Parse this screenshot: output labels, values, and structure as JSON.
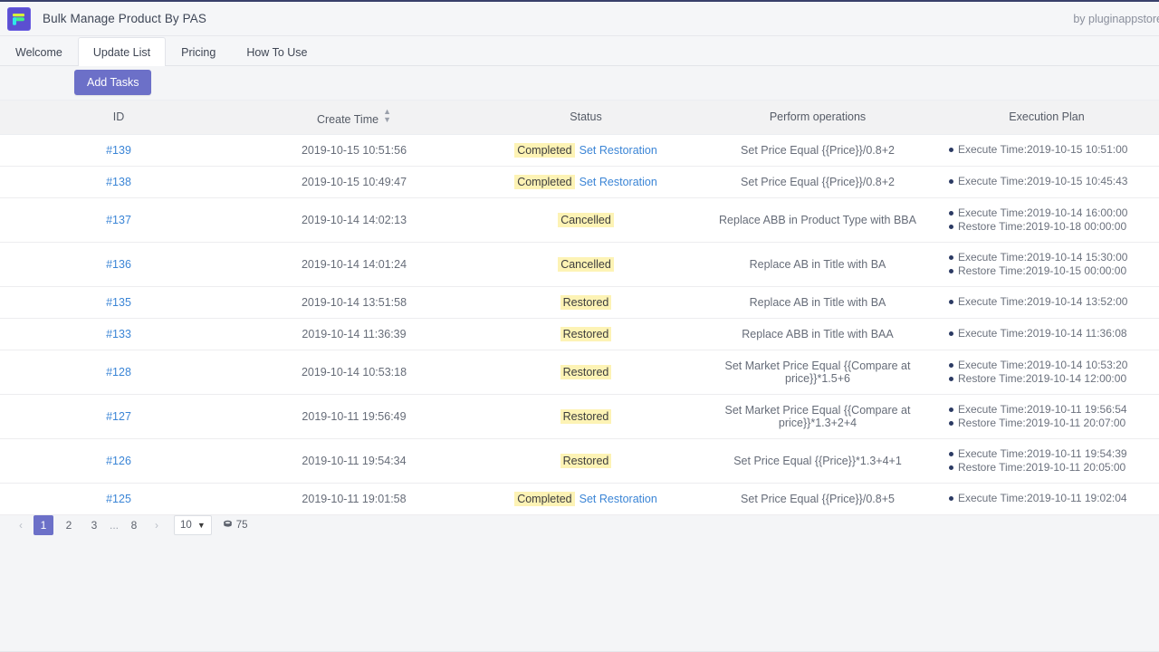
{
  "header": {
    "logo_icon": "app-logo-icon",
    "title": "Bulk Manage Product By PAS",
    "byline": "by pluginappstore"
  },
  "tabs": [
    {
      "label": "Welcome",
      "active": false
    },
    {
      "label": "Update List",
      "active": true
    },
    {
      "label": "Pricing",
      "active": false
    },
    {
      "label": "How To Use",
      "active": false
    }
  ],
  "toolbar": {
    "add_tasks_label": "Add Tasks"
  },
  "table": {
    "columns": [
      "ID",
      "Create Time",
      "Status",
      "Perform operations",
      "Execution Plan"
    ],
    "sort_column": "Create Time",
    "rows": [
      {
        "id": "#139",
        "create_time": "2019-10-15 10:51:56",
        "status": "Completed",
        "restoration_link": "Set Restoration",
        "operation": "Set Price Equal {{Price}}/0.8+2",
        "plan": [
          "Execute Time:2019-10-15 10:51:00"
        ]
      },
      {
        "id": "#138",
        "create_time": "2019-10-15 10:49:47",
        "status": "Completed",
        "restoration_link": "Set Restoration",
        "operation": "Set Price Equal {{Price}}/0.8+2",
        "plan": [
          "Execute Time:2019-10-15 10:45:43"
        ]
      },
      {
        "id": "#137",
        "create_time": "2019-10-14 14:02:13",
        "status": "Cancelled",
        "restoration_link": "",
        "operation": "Replace ABB in Product Type with BBA",
        "plan": [
          "Execute Time:2019-10-14 16:00:00",
          "Restore Time:2019-10-18 00:00:00"
        ]
      },
      {
        "id": "#136",
        "create_time": "2019-10-14 14:01:24",
        "status": "Cancelled",
        "restoration_link": "",
        "operation": "Replace AB in Title with BA",
        "plan": [
          "Execute Time:2019-10-14 15:30:00",
          "Restore Time:2019-10-15 00:00:00"
        ]
      },
      {
        "id": "#135",
        "create_time": "2019-10-14 13:51:58",
        "status": "Restored",
        "restoration_link": "",
        "operation": "Replace AB in Title with BA",
        "plan": [
          "Execute Time:2019-10-14 13:52:00"
        ]
      },
      {
        "id": "#133",
        "create_time": "2019-10-14 11:36:39",
        "status": "Restored",
        "restoration_link": "",
        "operation": "Replace ABB in Title with BAA",
        "plan": [
          "Execute Time:2019-10-14 11:36:08"
        ]
      },
      {
        "id": "#128",
        "create_time": "2019-10-14 10:53:18",
        "status": "Restored",
        "restoration_link": "",
        "operation": "Set Market Price Equal {{Compare at price}}*1.5+6",
        "plan": [
          "Execute Time:2019-10-14 10:53:20",
          "Restore Time:2019-10-14 12:00:00"
        ]
      },
      {
        "id": "#127",
        "create_time": "2019-10-11 19:56:49",
        "status": "Restored",
        "restoration_link": "",
        "operation": "Set Market Price Equal {{Compare at price}}*1.3+2+4",
        "plan": [
          "Execute Time:2019-10-11 19:56:54",
          "Restore Time:2019-10-11 20:07:00"
        ]
      },
      {
        "id": "#126",
        "create_time": "2019-10-11 19:54:34",
        "status": "Restored",
        "restoration_link": "",
        "operation": "Set Price Equal {{Price}}*1.3+4+1",
        "plan": [
          "Execute Time:2019-10-11 19:54:39",
          "Restore Time:2019-10-11 20:05:00"
        ]
      },
      {
        "id": "#125",
        "create_time": "2019-10-11 19:01:58",
        "status": "Completed",
        "restoration_link": "Set Restoration",
        "operation": "Set Price Equal {{Price}}/0.8+5",
        "plan": [
          "Execute Time:2019-10-11 19:02:04"
        ]
      }
    ]
  },
  "pagination": {
    "prev_label": "‹",
    "next_label": "›",
    "pages": [
      "1",
      "2",
      "3"
    ],
    "ellipsis": "...",
    "last_page": "8",
    "current_page": "1",
    "page_size": "10",
    "total_count": "75"
  },
  "colors": {
    "accent": "#6c70c8",
    "badge_bg": "#fdf3b5",
    "link": "#3b85d6",
    "topbar": "#39416b",
    "bullet": "#2b3a63"
  }
}
